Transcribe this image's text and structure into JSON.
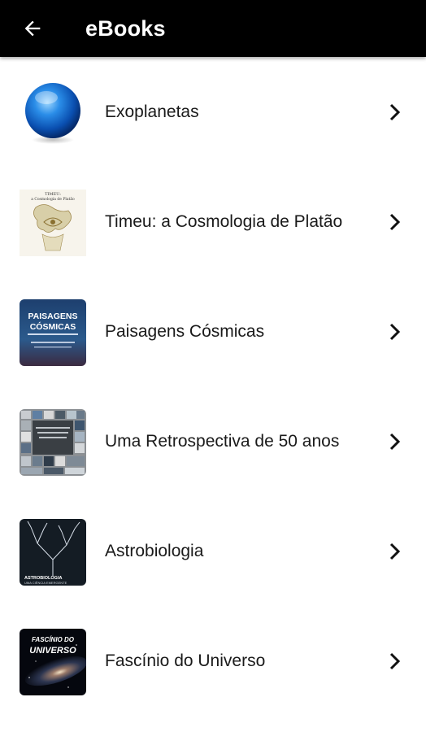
{
  "header": {
    "back_icon": "arrow-back-icon",
    "title": "eBooks"
  },
  "colors": {
    "appbar": "#000000",
    "title": "#ffffff",
    "text": "#1a1a1a"
  },
  "ebooks": [
    {
      "title": "Exoplanetas",
      "cover_icon": "blue-planet-cover"
    },
    {
      "title": "Timeu: a Cosmologia de Platão",
      "cover_icon": "timeu-cover",
      "cover_text": "TIMEU: a Cosmologia de Platão"
    },
    {
      "title": "Paisagens Cósmicas",
      "cover_icon": "paisagens-cover",
      "cover_text": "PAISAGENS CÓSMICAS"
    },
    {
      "title": "Uma Retrospectiva de 50 anos",
      "cover_icon": "retrospectiva-cover"
    },
    {
      "title": "Astrobiologia",
      "cover_icon": "astrobiologia-cover",
      "cover_text": "ASTROBIOLOGIA UMA CIÊNCIA EMERGENTE"
    },
    {
      "title": "Fascínio do Universo",
      "cover_icon": "fascinio-cover",
      "cover_text": "FASCÍNIO DO UNIVERSO"
    }
  ]
}
